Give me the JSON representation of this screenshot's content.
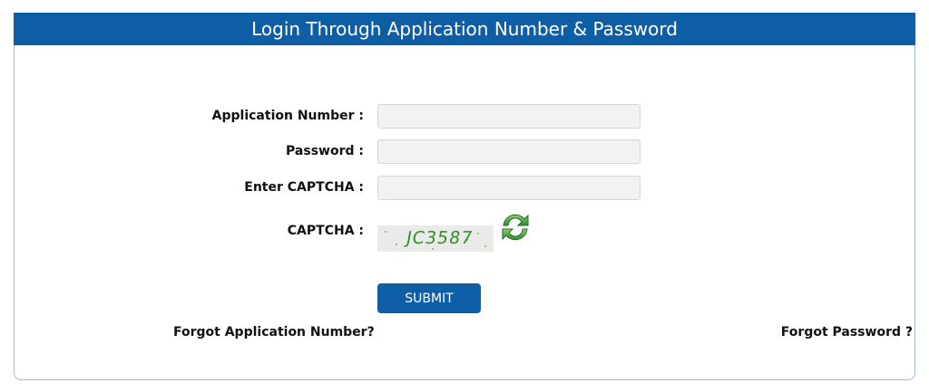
{
  "header": {
    "title": "Login Through Application Number & Password"
  },
  "form": {
    "application_number": {
      "label": "Application Number :",
      "value": "",
      "placeholder": ""
    },
    "password": {
      "label": "Password :",
      "value": "",
      "placeholder": ""
    },
    "captcha_input": {
      "label": "Enter CAPTCHA :",
      "value": "",
      "placeholder": ""
    },
    "captcha": {
      "label": "CAPTCHA :",
      "code": "JC3587",
      "refresh_icon": "refresh-icon"
    },
    "submit_label": "SUBMIT"
  },
  "links": {
    "forgot_application_number": "Forgot Application Number?",
    "forgot_password": "Forgot Password ?"
  },
  "colors": {
    "header_bg": "#0e5ea5",
    "button_bg": "#0e5ea5",
    "captcha_text": "#3a8a2c",
    "refresh_icon": "#2e8b32"
  }
}
